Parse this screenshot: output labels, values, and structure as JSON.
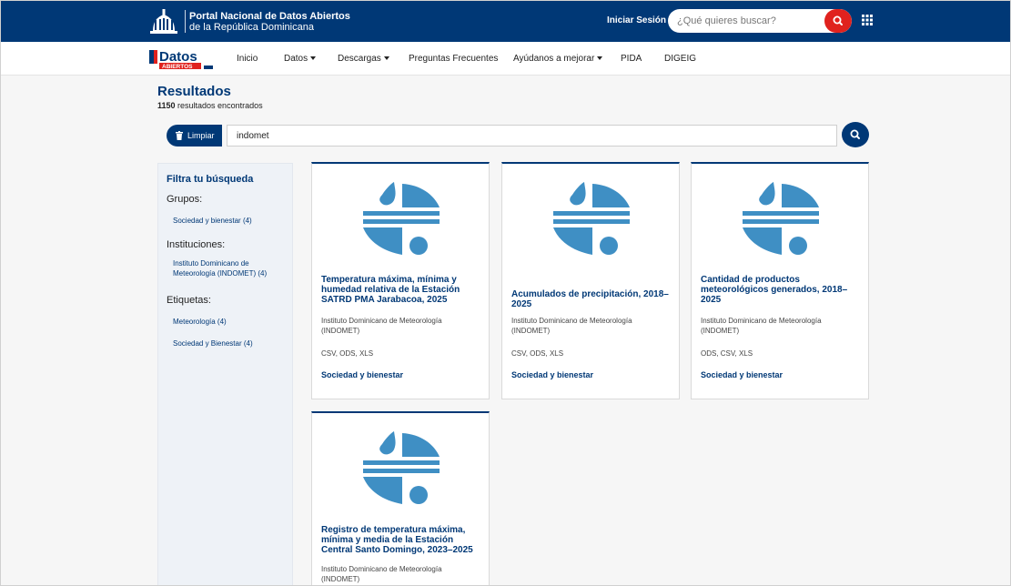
{
  "header": {
    "portal_title": "Portal Nacional de Datos Abiertos",
    "portal_subtitle": "de la República Dominicana",
    "login_label": "Iniciar Sesión",
    "search_placeholder": "¿Qué quieres buscar?"
  },
  "nav": {
    "logo_main": "Datos",
    "logo_sub": "ABIERTOS",
    "items": [
      {
        "label": "Inicio"
      },
      {
        "label": "Datos"
      },
      {
        "label": "Descargas"
      },
      {
        "label": "Preguntas Frecuentes"
      },
      {
        "label": "Ayúdanos a mejorar"
      },
      {
        "label": "PIDA"
      },
      {
        "label": "DIGEIG"
      }
    ]
  },
  "results": {
    "title": "Resultados",
    "count": "1150",
    "count_suffix": " resultados encontrados",
    "clear_label": "Limpiar",
    "query": "indomet"
  },
  "sidebar": {
    "title": "Filtra tu búsqueda",
    "groups_heading": "Grupos:",
    "groups": [
      "Sociedad y bienestar (4)"
    ],
    "institutions_heading": "Instituciones:",
    "institutions": [
      "Instituto Dominicano de Meteorología (INDOMET) (4)"
    ],
    "tags_heading": "Etiquetas:",
    "tags": [
      "Meteorología (4)",
      "Sociedad y Bienestar (4)"
    ]
  },
  "cards": [
    {
      "title": "Temperatura máxima, mínima y humedad relativa de la Estación SATRD PMA Jarabacoa, 2025",
      "institution": "Instituto Dominicano de Meteorología (INDOMET)",
      "formats": "CSV, ODS, XLS",
      "group": "Sociedad y bienestar"
    },
    {
      "title": "Acumulados de precipitación, 2018–2025",
      "institution": "Instituto Dominicano de Meteorología (INDOMET)",
      "formats": "CSV, ODS, XLS",
      "group": "Sociedad y bienestar"
    },
    {
      "title": "Cantidad de productos meteorológicos generados, 2018–2025",
      "institution": "Instituto Dominicano de Meteorología (INDOMET)",
      "formats": "ODS, CSV, XLS",
      "group": "Sociedad y bienestar"
    },
    {
      "title": "Registro de temperatura máxima, mínima y media de la Estación Central Santo Domingo, 2023–2025",
      "institution": "Instituto Dominicano de Meteorología (INDOMET)"
    }
  ],
  "colors": {
    "brand_navy": "#003876",
    "accent_red": "#e0221e",
    "logo_blue": "#3f8fc4"
  },
  "icons": {
    "seal": "national-seal-icon",
    "search": "search-icon",
    "apps": "apps-grid-icon",
    "trash": "trash-icon",
    "card_logo": "indomet-logo-icon"
  }
}
